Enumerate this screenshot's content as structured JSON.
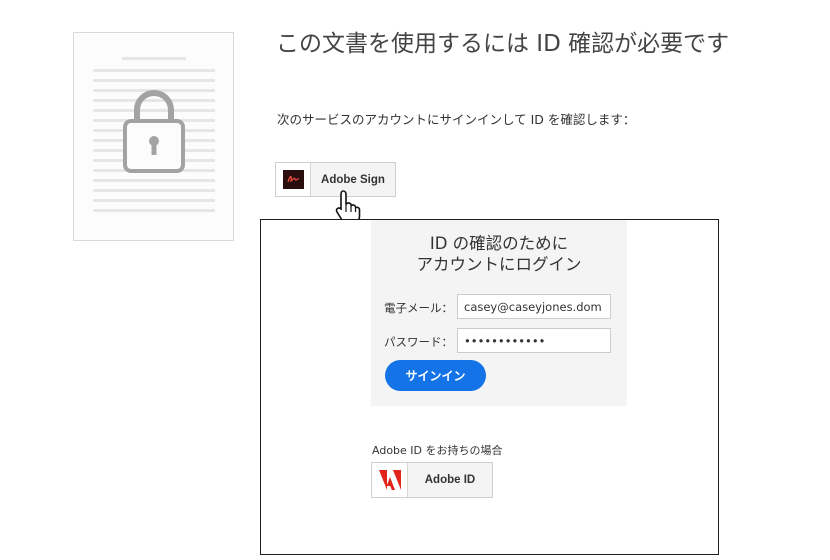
{
  "header": {
    "title": "この文書を使用するには ID 確認が必要です",
    "subtitle": "次のサービスのアカウントにサインインして ID を確認します："
  },
  "service": {
    "label": "Adobe Sign",
    "icon": "adobe-sign-logo-icon"
  },
  "login": {
    "heading_line1": "ID の確認のために",
    "heading_line2": "アカウントにログイン",
    "email_label": "電子メール：",
    "email_value": "casey@caseyjones.dom",
    "password_label": "パスワード：",
    "password_value": "••••••••••••",
    "signin_label": "サインイン"
  },
  "adobe_id": {
    "prompt": "Adobe ID をお持ちの場合",
    "label": "Adobe ID",
    "icon": "adobe-logo-icon"
  },
  "colors": {
    "primary_button": "#1473e6",
    "adobe_red": "#e1251b"
  }
}
